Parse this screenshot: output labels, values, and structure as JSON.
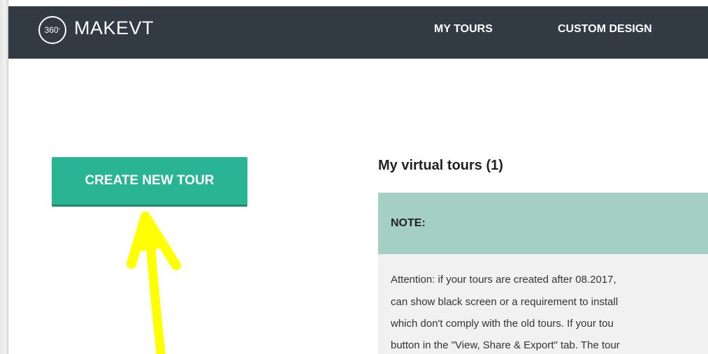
{
  "header": {
    "logo_badge": "360",
    "logo_degree": "°",
    "logo_text": "MAKEVT",
    "nav": [
      {
        "label": "MY TOURS"
      },
      {
        "label": "CUSTOM DESIGN"
      }
    ],
    "background": "#323b44"
  },
  "sidebar": {
    "create_button_label": "CREATE NEW TOUR",
    "button_color": "#29b593"
  },
  "main": {
    "title": "My virtual tours (1)",
    "note": {
      "label": "NOTE:",
      "lines": [
        "Attention: if your tours are created after 08.2017,",
        "can show black screen or a requirement to install",
        "which don't comply with the old tours. If your tou",
        "button in the \"View, Share & Export\" tab. The tour"
      ],
      "header_color": "#a3d0c2"
    }
  },
  "annotation": {
    "arrow_color": "#ffff00",
    "arrow_icon": "up-arrow-icon"
  }
}
